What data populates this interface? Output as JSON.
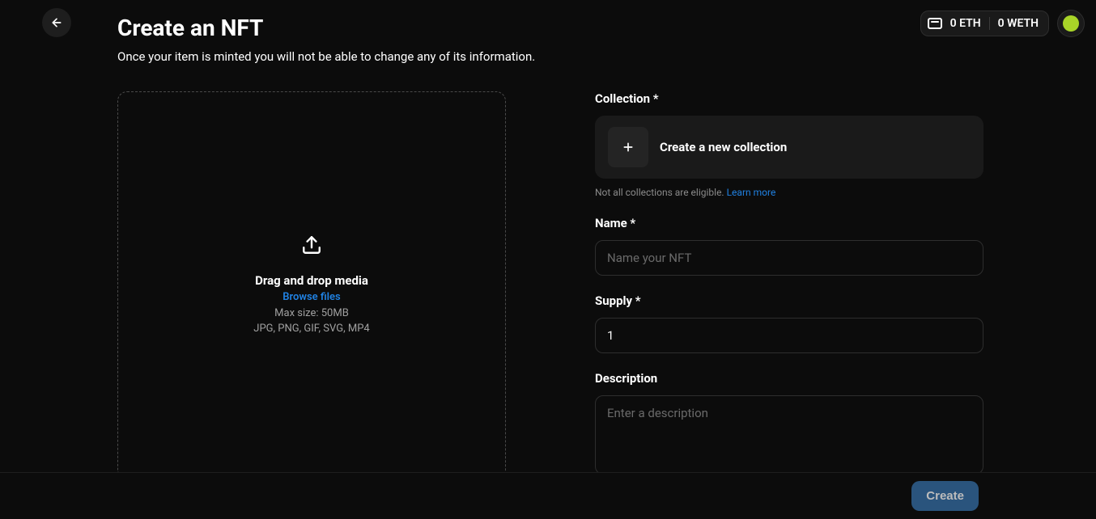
{
  "header": {
    "wallet_eth": "0 ETH",
    "wallet_weth": "0 WETH"
  },
  "page": {
    "title": "Create an NFT",
    "subtitle": "Once your item is minted you will not be able to change any of its information."
  },
  "dropzone": {
    "title": "Drag and drop media",
    "browse": "Browse files",
    "max_size": "Max size: 50MB",
    "formats": "JPG, PNG, GIF, SVG, MP4"
  },
  "form": {
    "collection": {
      "label": "Collection *",
      "create_text": "Create a new collection",
      "note": "Not all collections are eligible.",
      "learn_more": "Learn more"
    },
    "name": {
      "label": "Name *",
      "placeholder": "Name your NFT",
      "value": ""
    },
    "supply": {
      "label": "Supply *",
      "value": "1"
    },
    "description": {
      "label": "Description",
      "placeholder": "Enter a description",
      "value": ""
    }
  },
  "footer": {
    "create_label": "Create"
  }
}
